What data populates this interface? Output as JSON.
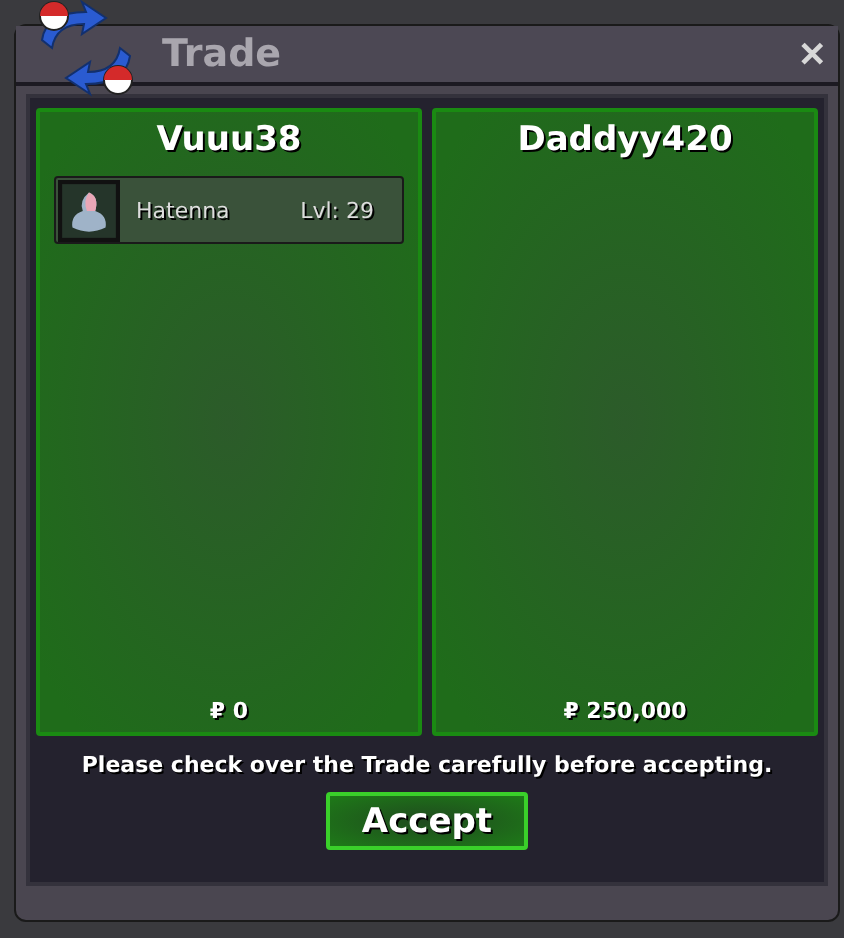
{
  "window": {
    "title": "Trade",
    "close": "✕"
  },
  "offers": [
    {
      "player": "Vuuu38",
      "items": [
        {
          "name": "Hatenna",
          "level": "Lvl: 29"
        }
      ],
      "money": "₽ 0"
    },
    {
      "player": "Daddyy420",
      "money": "₽ 250,000"
    }
  ],
  "notice": "Please check over the Trade carefully before accepting.",
  "accept_button": "Accept"
}
